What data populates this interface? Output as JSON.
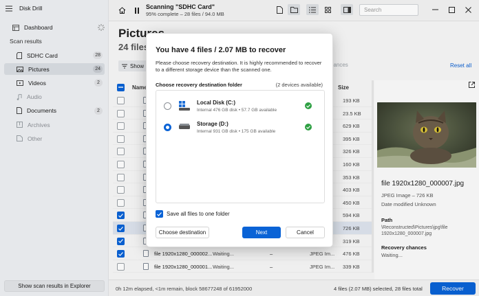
{
  "app": {
    "title": "Disk Drill"
  },
  "sidebar": {
    "dashboard": "Dashboard",
    "scan_results_label": "Scan results",
    "items": [
      {
        "label": "SDHC Card",
        "count": "28",
        "icon": "sd-card-icon"
      },
      {
        "label": "Pictures",
        "count": "24",
        "icon": "picture-icon",
        "active": true
      },
      {
        "label": "Videos",
        "count": "2",
        "icon": "video-icon"
      },
      {
        "label": "Audio",
        "count": "",
        "icon": "music-icon",
        "disabled": true
      },
      {
        "label": "Documents",
        "count": "2",
        "icon": "document-icon"
      },
      {
        "label": "Archives",
        "count": "",
        "icon": "archive-icon",
        "disabled": true
      },
      {
        "label": "Other",
        "count": "",
        "icon": "other-icon",
        "disabled": true
      }
    ],
    "show_in_explorer": "Show scan results in Explorer"
  },
  "topbar": {
    "scan_title": "Scanning \"SDHC Card\"",
    "scan_sub": "95% complete – 28 files / 94.0 MB",
    "search_placeholder": "Search"
  },
  "main": {
    "page_title": "Pictures",
    "page_subtitle": "24 files /",
    "show_label": "Show",
    "chances_label": "chances",
    "reset_all": "Reset all",
    "col_name": "Name",
    "col_size": "Size",
    "rows": [
      {
        "checked": false,
        "name": "",
        "status": "",
        "dash": "",
        "type": "",
        "size": "193 KB"
      },
      {
        "checked": false,
        "name": "",
        "status": "",
        "dash": "",
        "type": "",
        "size": "23.5 KB"
      },
      {
        "checked": false,
        "name": "",
        "status": "",
        "dash": "",
        "type": "",
        "size": "629 KB"
      },
      {
        "checked": false,
        "name": "",
        "status": "",
        "dash": "",
        "type": "",
        "size": "395 KB"
      },
      {
        "checked": false,
        "name": "",
        "status": "",
        "dash": "",
        "type": "",
        "size": "326 KB"
      },
      {
        "checked": false,
        "name": "",
        "status": "",
        "dash": "",
        "type": "",
        "size": "160 KB"
      },
      {
        "checked": false,
        "name": "",
        "status": "",
        "dash": "",
        "type": "",
        "size": "353 KB"
      },
      {
        "checked": false,
        "name": "",
        "status": "",
        "dash": "",
        "type": "",
        "size": "403 KB"
      },
      {
        "checked": false,
        "name": "",
        "status": "",
        "dash": "",
        "type": "",
        "size": "450 KB"
      },
      {
        "checked": true,
        "name": "",
        "status": "",
        "dash": "",
        "type": "",
        "size": "594 KB"
      },
      {
        "checked": true,
        "name": "",
        "status": "",
        "dash": "",
        "type": "",
        "size": "726 KB",
        "selected": true
      },
      {
        "checked": true,
        "name": "",
        "status": "",
        "dash": "",
        "type": "",
        "size": "319 KB"
      },
      {
        "checked": true,
        "name": "file 1920x1280_000002...",
        "status": "Waiting...",
        "dash": "–",
        "type": "JPEG Im...",
        "size": "476 KB"
      },
      {
        "checked": false,
        "name": "file 1920x1280_000001...",
        "status": "Waiting...",
        "dash": "–",
        "type": "JPEG Im...",
        "size": "339 KB"
      }
    ]
  },
  "preview": {
    "file_name": "file 1920x1280_000007.jpg",
    "file_type": "JPEG Image – 726 KB",
    "date_modified": "Date modified Unknown",
    "path_label": "Path",
    "path_value": "\\Reconstructed\\Pictures\\jpg\\file 1920x1280_000007.jpg",
    "chances_label": "Recovery chances",
    "chances_value": "Waiting..."
  },
  "status": {
    "elapsed": "0h 12m elapsed, <1m remain, block 58677248 of 61952000",
    "selected_info": "4 files (2.07 MB) selected, 28 files total",
    "recover_label": "Recover"
  },
  "modal": {
    "title": "You have 4 files / 2.07 MB to recover",
    "description": "Please choose recovery destination. It is highly recommended to recover to a different storage device than the scanned one.",
    "section_label": "Choose recovery destination folder",
    "device_count": "(2 devices available)",
    "devices": [
      {
        "name": "Local Disk (C:)",
        "info": "Internal 476 GB disk • 57.7 GB available",
        "selected": false,
        "icon": "windows-disk-icon"
      },
      {
        "name": "Storage (D:)",
        "info": "Internal 931 GB disk • 175 GB available",
        "selected": true,
        "icon": "drive-icon"
      }
    ],
    "save_all_label": "Save all files to one folder",
    "choose_dest_label": "Choose destination",
    "next_label": "Next",
    "cancel_label": "Cancel"
  },
  "colors": {
    "accent": "#0a63d6",
    "success": "#2ea043"
  }
}
